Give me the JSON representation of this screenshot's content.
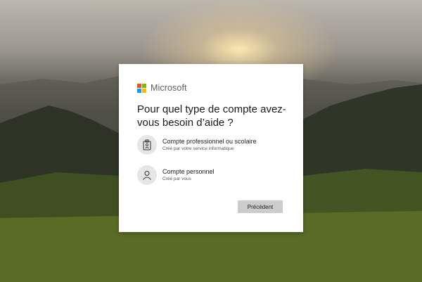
{
  "brand": {
    "name": "Microsoft",
    "colors": [
      "#f25022",
      "#7fba00",
      "#00a4ef",
      "#ffb900"
    ]
  },
  "dialog": {
    "title": "Pour quel type de compte avez-vous besoin d’aide ?",
    "options": [
      {
        "icon": "badge-icon",
        "title": "Compte professionnel ou scolaire",
        "subtitle": "Créé par votre service informatique"
      },
      {
        "icon": "person-icon",
        "title": "Compte personnel",
        "subtitle": "Créé par vous"
      }
    ],
    "back_label": "Précédent"
  }
}
